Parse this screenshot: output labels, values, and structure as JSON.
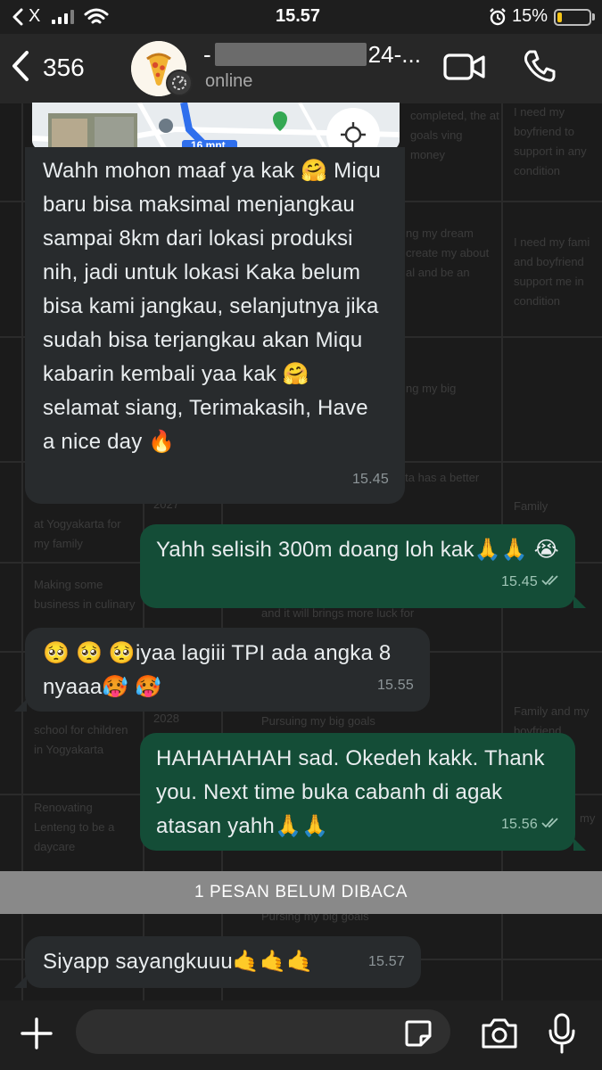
{
  "status_bar": {
    "back_app_label": "X",
    "time": "15.57",
    "battery_percent_label": "15%",
    "battery_level": 0.15,
    "battery_color": "#f5c518",
    "icons": [
      "chevron-left-icon",
      "signal-icon",
      "wifi-icon",
      "alarm-icon",
      "battery-icon"
    ]
  },
  "header": {
    "unread_count": "356",
    "contact_name_visible": "24-...",
    "contact_name_prefix": "-",
    "contact_status": "online",
    "icons": [
      "back-icon",
      "avatar",
      "status-ring-icon",
      "video-call-icon",
      "phone-icon"
    ]
  },
  "messages": [
    {
      "direction": "incoming",
      "text": "Wahh mohon maaf ya kak 🤗 Miqu baru bisa maksimal menjangkau sampai 8km dari lokasi produksi nih, jadi untuk lokasi Kaka belum bisa kami jangkau, selanjutnya jika sudah bisa terjangkau akan Miqu kabarin kembali yaa kak 🤗 selamat siang, Terimakasih, Have a nice day 🔥",
      "time": "15.45",
      "attachment": {
        "type": "map",
        "duration_label": "16 mnt"
      }
    },
    {
      "direction": "outgoing",
      "text": "Yahh selisih 300m doang loh kak🙏🙏 😭",
      "time": "15.45",
      "read": true
    },
    {
      "direction": "incoming",
      "text": "🥺 🥺 🥺iyaa lagiii TPI ada angka 8 nyaaa🥵 🥵",
      "time": "15.55"
    },
    {
      "direction": "outgoing",
      "text": "HAHAHAHAH sad. Okedeh kakk. Thank you. Next time buka cabanh di agak atasan yahh🙏🙏",
      "time": "15.56",
      "read": true
    },
    {
      "direction": "incoming",
      "text": "Siyapp sayangkuuu🤙🤙🤙",
      "time": "15.57"
    }
  ],
  "unread_divider": "1 PESAN BELUM DIBACA",
  "input_bar": {
    "placeholder": "",
    "icons": [
      "plus-icon",
      "sticker-icon",
      "camera-icon",
      "microphone-icon"
    ]
  },
  "wallpaper_text": {
    "col1": [
      "at Yogyakarta for my family",
      "Making some business in culinary",
      "school for children in Yogyakarta",
      "Renovating Lenteng to be a daycare"
    ],
    "col2": [
      "2027",
      "2028"
    ],
    "col3": [
      "completed, the at goals ving money",
      "ng my dream create my about al and be an",
      "ng my big",
      "n my wn, I believe Yogyakarta has a better luck to",
      "and it will brings more luck for",
      "Pursuing my big goals",
      "Pursing my big goals"
    ],
    "col4": [
      "I need my boyfriend to support in any condition",
      "I need my fami and boyfriend support me in condition",
      "Family",
      "Family and my boyfriend",
      "my"
    ]
  },
  "colors": {
    "background": "#1b1b1b",
    "incoming_bubble": "#282b2d",
    "outgoing_bubble": "#144d37",
    "divider": "#898989"
  }
}
